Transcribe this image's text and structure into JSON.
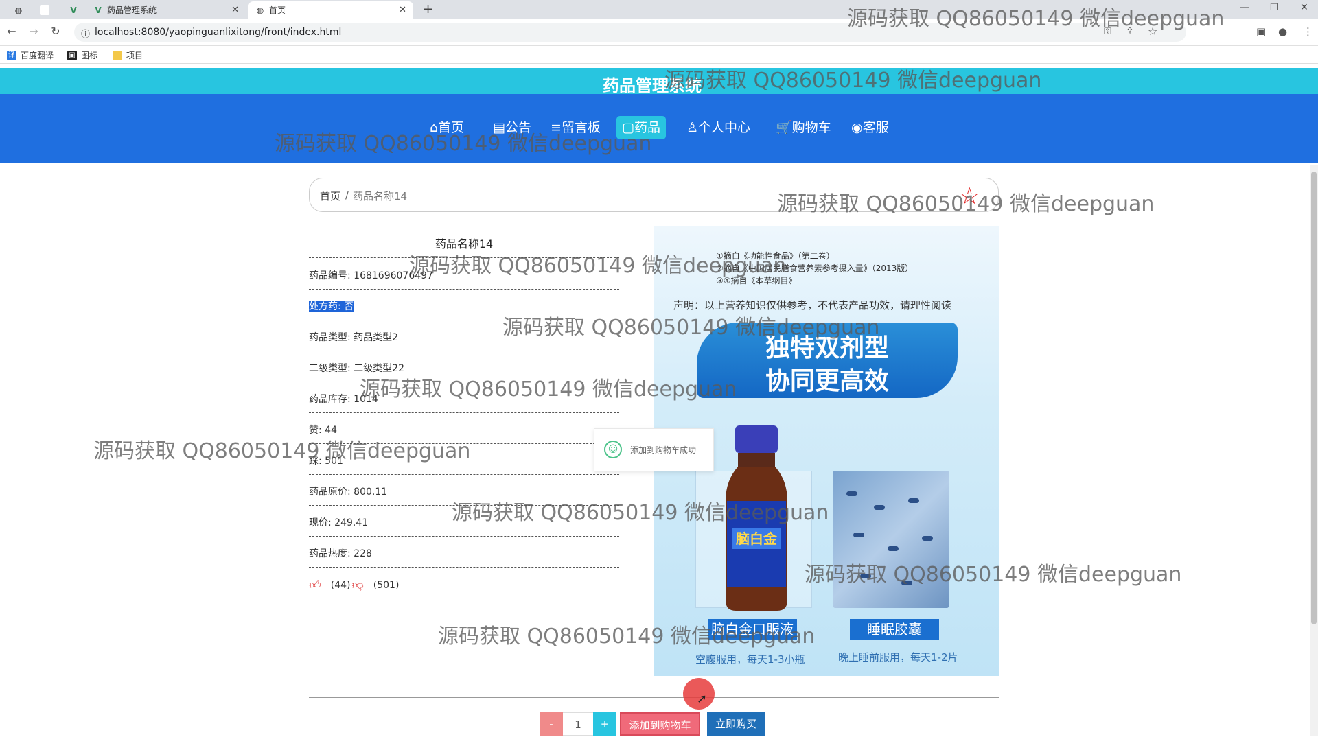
{
  "browser": {
    "tabs": [
      {
        "title": "药品管理系统",
        "icon": "vue-icon"
      },
      {
        "title": "首页",
        "icon": "globe-icon"
      }
    ],
    "url": "localhost:8080/yaopinguanlixitong/front/index.html",
    "bookmarks": [
      "百度翻译",
      "图标",
      "项目"
    ]
  },
  "site": {
    "title": "药品管理系统",
    "nav": [
      {
        "label": "⌂首页",
        "active": false
      },
      {
        "label": "▤公告",
        "active": false
      },
      {
        "label": "≡留言板",
        "active": false
      },
      {
        "label": "▢药品",
        "active": true
      },
      {
        "label": "♙个人中心",
        "active": false
      },
      {
        "label": "🛒购物车",
        "active": false
      },
      {
        "label": "◉客服",
        "active": false
      }
    ]
  },
  "breadcrumb": {
    "home": "首页",
    "sep": "/",
    "current": "药品名称14"
  },
  "product": {
    "name": "药品名称14",
    "fields": [
      "药品编号: 1681696076497",
      "处方药: 否",
      "药品类型: 药品类型2",
      "二级类型: 二级类型22",
      "药品库存: 1014",
      "赞: 44",
      "踩: 501",
      "药品原价: 800.11",
      "现价: 249.41",
      "药品热度: 228"
    ],
    "likes": "(44)",
    "dislikes": "(501)"
  },
  "image": {
    "ref1": "①摘自《功能性食品》（第二卷）",
    "ref2": "②摘自《中国居民膳食营养素参考摄入量》（2013版）",
    "ref3": "③④摘自《本草纲目》",
    "disclaimer": "声明：以上营养知识仅供参考，不代表产品功效，请理性阅读",
    "banner_l1": "独特双剂型",
    "banner_l2": "协同更高效",
    "label_left": "脑白金口服液",
    "label_right": "睡眠胶囊",
    "sub_left": "空腹服用，每天1-3小瓶",
    "sub_right": "晚上睡前服用，每天1-2片",
    "bottle_text": "脑白金"
  },
  "toast": {
    "text": "添加到购物车成功"
  },
  "cart": {
    "minus": "-",
    "qty": "1",
    "plus": "+",
    "add": "添加到购物车",
    "buy": "立即购买"
  },
  "watermark": "源码获取 QQ86050149 微信deepguan"
}
